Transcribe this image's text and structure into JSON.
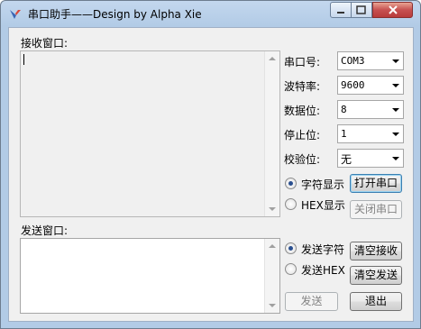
{
  "window": {
    "title": "串口助手——Design by Alpha Xie"
  },
  "receive": {
    "label": "接收窗口:",
    "text": ""
  },
  "send": {
    "label": "发送窗口:",
    "text": ""
  },
  "settings": {
    "port": {
      "label": "串口号:",
      "value": "COM3"
    },
    "baud": {
      "label": "波特率:",
      "value": "9600"
    },
    "databits": {
      "label": "数据位:",
      "value": "8"
    },
    "stopbits": {
      "label": "停止位:",
      "value": "1"
    },
    "parity": {
      "label": "校验位:",
      "value": "无"
    }
  },
  "display_mode": {
    "char_label": "字符显示",
    "hex_label": "HEX显示",
    "selected": "char"
  },
  "send_mode": {
    "char_label": "发送字符",
    "hex_label": "发送HEX",
    "selected": "char"
  },
  "buttons": {
    "open_port": "打开串口",
    "close_port": "关闭串口",
    "clear_receive": "清空接收",
    "clear_send": "清空发送",
    "send": "发送",
    "exit": "退出"
  },
  "colors": {
    "accent": "#2a4f8f",
    "titlebar": "#b9d1ea",
    "close": "#c75050"
  }
}
